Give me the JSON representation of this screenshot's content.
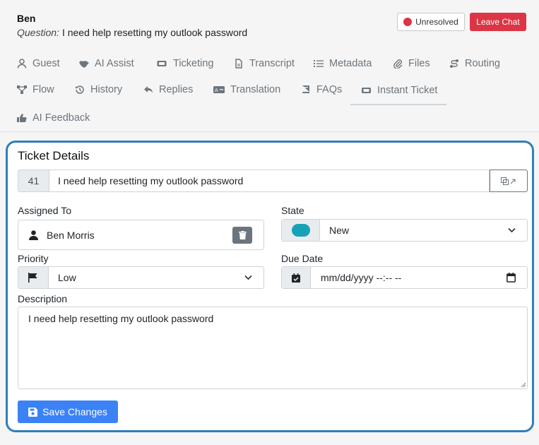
{
  "chat": {
    "name": "Ben",
    "question_label": "Question:",
    "question_text": "I need help resetting my outlook password"
  },
  "actions": {
    "unresolved_label": "Unresolved",
    "leave_label": "Leave Chat"
  },
  "tabs": [
    {
      "label": "Guest",
      "icon": "user-icon"
    },
    {
      "label": "AI Assist",
      "icon": "handshake-icon"
    },
    {
      "label": "Ticketing",
      "icon": "ticket-icon"
    },
    {
      "label": "Transcript",
      "icon": "file-icon"
    },
    {
      "label": "Metadata",
      "icon": "list-icon"
    },
    {
      "label": "Files",
      "icon": "paperclip-icon"
    },
    {
      "label": "Routing",
      "icon": "route-icon"
    },
    {
      "label": "Flow",
      "icon": "flow-icon"
    },
    {
      "label": "History",
      "icon": "history-icon"
    },
    {
      "label": "Replies",
      "icon": "reply-icon"
    },
    {
      "label": "Translation",
      "icon": "translation-icon"
    },
    {
      "label": "FAQs",
      "icon": "book-icon"
    },
    {
      "label": "Instant Ticket",
      "icon": "ticket-icon"
    },
    {
      "label": "AI Feedback",
      "icon": "thumbs-up-icon"
    }
  ],
  "active_tab": "Instant Ticket",
  "ticket": {
    "heading": "Ticket Details",
    "id": "41",
    "title": "I need help resetting my outlook password",
    "assigned_label": "Assigned To",
    "assignee": "Ben Morris",
    "state_label": "State",
    "state": "New",
    "priority_label": "Priority",
    "priority": "Low",
    "due_label": "Due Date",
    "due_placeholder": "mm/dd/yyyy --:-- --",
    "description_label": "Description",
    "description": "I need help resetting my outlook password",
    "save_label": "Save Changes"
  },
  "colors": {
    "accent": "#2f7fb8",
    "danger": "#dc3545",
    "primary": "#3b82f6",
    "toggle": "#17a2b8"
  }
}
